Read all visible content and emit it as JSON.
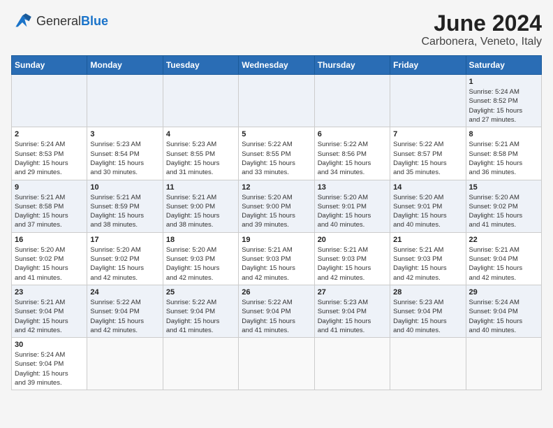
{
  "header": {
    "logo_general": "General",
    "logo_blue": "Blue",
    "month_year": "June 2024",
    "location": "Carbonera, Veneto, Italy"
  },
  "weekdays": [
    "Sunday",
    "Monday",
    "Tuesday",
    "Wednesday",
    "Thursday",
    "Friday",
    "Saturday"
  ],
  "weeks": [
    [
      {
        "day": "",
        "info": ""
      },
      {
        "day": "",
        "info": ""
      },
      {
        "day": "",
        "info": ""
      },
      {
        "day": "",
        "info": ""
      },
      {
        "day": "",
        "info": ""
      },
      {
        "day": "",
        "info": ""
      },
      {
        "day": "1",
        "info": "Sunrise: 5:24 AM\nSunset: 8:52 PM\nDaylight: 15 hours\nand 27 minutes."
      }
    ],
    [
      {
        "day": "2",
        "info": "Sunrise: 5:24 AM\nSunset: 8:53 PM\nDaylight: 15 hours\nand 29 minutes."
      },
      {
        "day": "3",
        "info": "Sunrise: 5:23 AM\nSunset: 8:54 PM\nDaylight: 15 hours\nand 30 minutes."
      },
      {
        "day": "4",
        "info": "Sunrise: 5:23 AM\nSunset: 8:55 PM\nDaylight: 15 hours\nand 31 minutes."
      },
      {
        "day": "5",
        "info": "Sunrise: 5:22 AM\nSunset: 8:55 PM\nDaylight: 15 hours\nand 33 minutes."
      },
      {
        "day": "6",
        "info": "Sunrise: 5:22 AM\nSunset: 8:56 PM\nDaylight: 15 hours\nand 34 minutes."
      },
      {
        "day": "7",
        "info": "Sunrise: 5:22 AM\nSunset: 8:57 PM\nDaylight: 15 hours\nand 35 minutes."
      },
      {
        "day": "8",
        "info": "Sunrise: 5:21 AM\nSunset: 8:58 PM\nDaylight: 15 hours\nand 36 minutes."
      }
    ],
    [
      {
        "day": "9",
        "info": "Sunrise: 5:21 AM\nSunset: 8:58 PM\nDaylight: 15 hours\nand 37 minutes."
      },
      {
        "day": "10",
        "info": "Sunrise: 5:21 AM\nSunset: 8:59 PM\nDaylight: 15 hours\nand 38 minutes."
      },
      {
        "day": "11",
        "info": "Sunrise: 5:21 AM\nSunset: 9:00 PM\nDaylight: 15 hours\nand 38 minutes."
      },
      {
        "day": "12",
        "info": "Sunrise: 5:20 AM\nSunset: 9:00 PM\nDaylight: 15 hours\nand 39 minutes."
      },
      {
        "day": "13",
        "info": "Sunrise: 5:20 AM\nSunset: 9:01 PM\nDaylight: 15 hours\nand 40 minutes."
      },
      {
        "day": "14",
        "info": "Sunrise: 5:20 AM\nSunset: 9:01 PM\nDaylight: 15 hours\nand 40 minutes."
      },
      {
        "day": "15",
        "info": "Sunrise: 5:20 AM\nSunset: 9:02 PM\nDaylight: 15 hours\nand 41 minutes."
      }
    ],
    [
      {
        "day": "16",
        "info": "Sunrise: 5:20 AM\nSunset: 9:02 PM\nDaylight: 15 hours\nand 41 minutes."
      },
      {
        "day": "17",
        "info": "Sunrise: 5:20 AM\nSunset: 9:02 PM\nDaylight: 15 hours\nand 42 minutes."
      },
      {
        "day": "18",
        "info": "Sunrise: 5:20 AM\nSunset: 9:03 PM\nDaylight: 15 hours\nand 42 minutes."
      },
      {
        "day": "19",
        "info": "Sunrise: 5:21 AM\nSunset: 9:03 PM\nDaylight: 15 hours\nand 42 minutes."
      },
      {
        "day": "20",
        "info": "Sunrise: 5:21 AM\nSunset: 9:03 PM\nDaylight: 15 hours\nand 42 minutes."
      },
      {
        "day": "21",
        "info": "Sunrise: 5:21 AM\nSunset: 9:03 PM\nDaylight: 15 hours\nand 42 minutes."
      },
      {
        "day": "22",
        "info": "Sunrise: 5:21 AM\nSunset: 9:04 PM\nDaylight: 15 hours\nand 42 minutes."
      }
    ],
    [
      {
        "day": "23",
        "info": "Sunrise: 5:21 AM\nSunset: 9:04 PM\nDaylight: 15 hours\nand 42 minutes."
      },
      {
        "day": "24",
        "info": "Sunrise: 5:22 AM\nSunset: 9:04 PM\nDaylight: 15 hours\nand 42 minutes."
      },
      {
        "day": "25",
        "info": "Sunrise: 5:22 AM\nSunset: 9:04 PM\nDaylight: 15 hours\nand 41 minutes."
      },
      {
        "day": "26",
        "info": "Sunrise: 5:22 AM\nSunset: 9:04 PM\nDaylight: 15 hours\nand 41 minutes."
      },
      {
        "day": "27",
        "info": "Sunrise: 5:23 AM\nSunset: 9:04 PM\nDaylight: 15 hours\nand 41 minutes."
      },
      {
        "day": "28",
        "info": "Sunrise: 5:23 AM\nSunset: 9:04 PM\nDaylight: 15 hours\nand 40 minutes."
      },
      {
        "day": "29",
        "info": "Sunrise: 5:24 AM\nSunset: 9:04 PM\nDaylight: 15 hours\nand 40 minutes."
      }
    ],
    [
      {
        "day": "30",
        "info": "Sunrise: 5:24 AM\nSunset: 9:04 PM\nDaylight: 15 hours\nand 39 minutes."
      },
      {
        "day": "",
        "info": ""
      },
      {
        "day": "",
        "info": ""
      },
      {
        "day": "",
        "info": ""
      },
      {
        "day": "",
        "info": ""
      },
      {
        "day": "",
        "info": ""
      },
      {
        "day": "",
        "info": ""
      }
    ]
  ]
}
